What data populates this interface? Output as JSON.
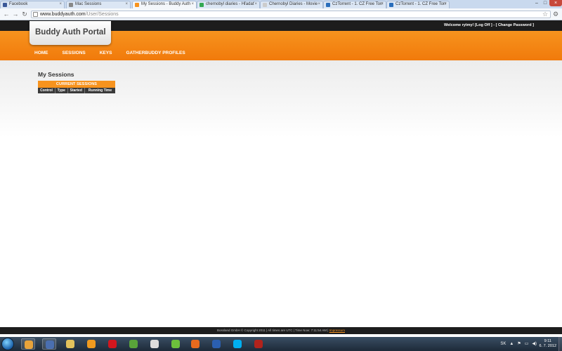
{
  "browser": {
    "tabs": [
      {
        "title": "Facebook",
        "icon_color": "#3b5998",
        "active": false
      },
      {
        "title": "Mac Sessions",
        "icon_color": "#888888",
        "active": false
      },
      {
        "title": "My Sessions - Buddy Auth",
        "icon_color": "#f7931e",
        "active": true
      },
      {
        "title": "chernobyl diaries - Hľadať",
        "icon_color": "#34a853",
        "active": false
      },
      {
        "title": "Chernobyl Diaries - Movie",
        "icon_color": "#cccccc",
        "active": false
      },
      {
        "title": "CzTorrent - 1. CZ Free Torr",
        "icon_color": "#2a6ebb",
        "active": false
      },
      {
        "title": "CzTorrent - 1. CZ Free Torr",
        "icon_color": "#2a6ebb",
        "active": false
      }
    ],
    "url_host": "www.buddyauth.com",
    "url_path": "/User/Sessions"
  },
  "site": {
    "logo": "Buddy Auth Portal",
    "welcome_prefix": "Welcome rytmy! [",
    "logoff": "Log Off",
    "separator": " ] - [ ",
    "change_password": "Change Password",
    "welcome_suffix": " ]",
    "nav": [
      "HOME",
      "SESSIONS",
      "KEYS",
      "GATHERBUDDY PROFILES"
    ]
  },
  "page": {
    "title": "My Sessions",
    "table": {
      "caption": "CURRENT SESSIONS",
      "columns": [
        "Control",
        "Type",
        "Started",
        "Running Time"
      ]
    }
  },
  "footer": {
    "text": "Bossland GmbH © Copyright 2011 | All times are UTC | Time Now: 7:11:54 AM | ",
    "link": "Impressum"
  },
  "taskbar": {
    "apps": [
      {
        "name": "chrome-icon",
        "color": "#e8a33a"
      },
      {
        "name": "save-icon",
        "color": "#4a6fb0"
      },
      {
        "name": "folder-icon",
        "color": "#e2c25c"
      },
      {
        "name": "media-player-icon",
        "color": "#f09a1f"
      },
      {
        "name": "opera-icon",
        "color": "#d2161e"
      },
      {
        "name": "utorrent-icon",
        "color": "#59a43a"
      },
      {
        "name": "remote-icon",
        "color": "#dddddd"
      },
      {
        "name": "icq-icon",
        "color": "#6cc03c"
      },
      {
        "name": "app-d-icon",
        "color": "#e86a1e"
      },
      {
        "name": "word-icon",
        "color": "#2b5fb0"
      },
      {
        "name": "skype-icon",
        "color": "#00aff0"
      },
      {
        "name": "app-red-icon",
        "color": "#b2231c"
      }
    ],
    "lang": "SK",
    "time": "9:11",
    "date": "6. 7. 2012"
  }
}
